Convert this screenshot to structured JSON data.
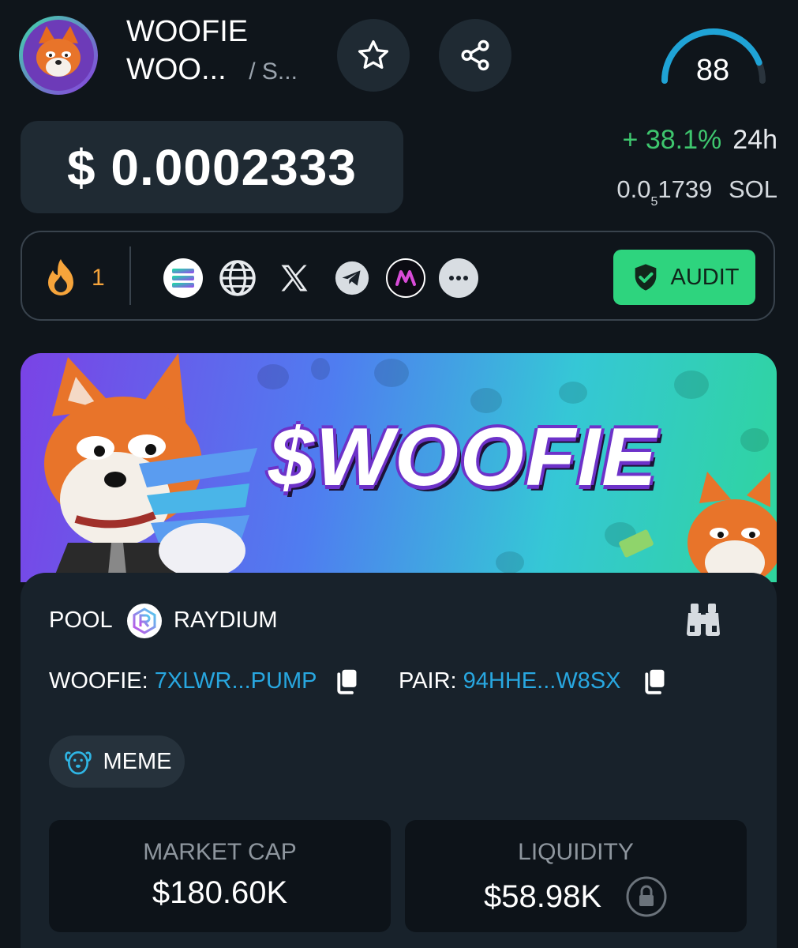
{
  "header": {
    "token_name_line1": "WOOFIE",
    "token_name_line2": "WOO...",
    "chain_short": "/ S...",
    "score": "88"
  },
  "price": {
    "usd": "$ 0.0002333",
    "change_pct": "+ 38.1%",
    "change_period": "24h",
    "sol_lead": "0.0",
    "sol_zero_count": "5",
    "sol_tail": "1739",
    "sol_unit": "SOL"
  },
  "socials": {
    "boosts": "1",
    "icons": [
      "solana-icon",
      "website-icon",
      "x-icon",
      "telegram-icon",
      "moonshot-icon",
      "more-icon"
    ],
    "audit_label": "AUDIT"
  },
  "banner": {
    "title": "$WOOFIE"
  },
  "pool": {
    "label": "POOL",
    "dex": "RAYDIUM",
    "token_key": "WOOFIE:",
    "token_addr": "7XLWR...PUMP",
    "pair_key": "PAIR:",
    "pair_addr": "94HHE...W8SX",
    "tag": "MEME"
  },
  "stats": {
    "market_cap_label": "MARKET CAP",
    "market_cap_value": "$180.60K",
    "liquidity_label": "LIQUIDITY",
    "liquidity_value": "$58.98K"
  },
  "colors": {
    "background": "#0f151b",
    "card": "#1f2a33",
    "positive": "#3ec66e",
    "audit": "#2ed47e",
    "link": "#28a7e0",
    "gauge": "#1fa3d6"
  },
  "score_gauge": {
    "value": 88,
    "max": 100
  }
}
